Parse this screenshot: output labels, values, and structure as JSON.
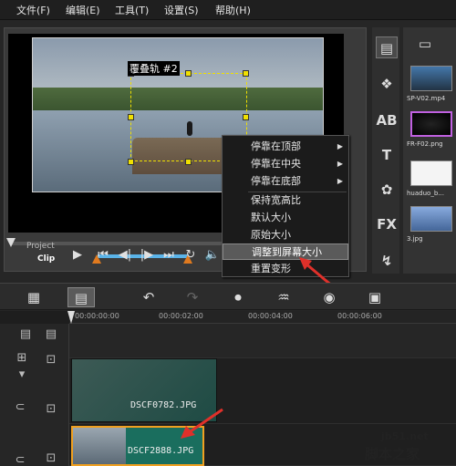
{
  "menu": {
    "items": [
      "文件(F)",
      "编辑(E)",
      "工具(T)",
      "设置(S)",
      "帮助(H)"
    ]
  },
  "preview": {
    "overlay_title": "覆叠轨 #2"
  },
  "player": {
    "mode_project": "Project",
    "mode_clip": "Clip"
  },
  "library": {
    "thumbs": [
      {
        "label": "SP-V02.mp4"
      },
      {
        "label": "FR-F02.png"
      },
      {
        "label": "huaduo_b..."
      },
      {
        "label": "3.jpg"
      }
    ]
  },
  "context_menu": {
    "items": [
      {
        "label": "停靠在顶部",
        "submenu": true
      },
      {
        "label": "停靠在中央",
        "submenu": true
      },
      {
        "label": "停靠在底部",
        "submenu": true
      },
      {
        "label": "保持宽高比",
        "submenu": false
      },
      {
        "label": "默认大小",
        "submenu": false
      },
      {
        "label": "原始大小",
        "submenu": false
      },
      {
        "label": "调整到屏幕大小",
        "submenu": false
      },
      {
        "label": "重置变形",
        "submenu": false
      }
    ],
    "highlighted_index": 6
  },
  "timeline": {
    "ruler": [
      "00:00:00:00",
      "00:00:02:00",
      "00:00:04:00",
      "00:00:06:00"
    ],
    "clips": [
      {
        "label": "DSCF0782.JPG"
      },
      {
        "label": "DSCF2888.JPG"
      }
    ]
  },
  "watermark": {
    "line1": "jb51.net",
    "line2": "脚本之家"
  },
  "colors": {
    "highlight": "#5a5a5a",
    "overlay_frame": "#f0e000",
    "annotation": "#e0302a",
    "trim": "#5ab3e8"
  }
}
